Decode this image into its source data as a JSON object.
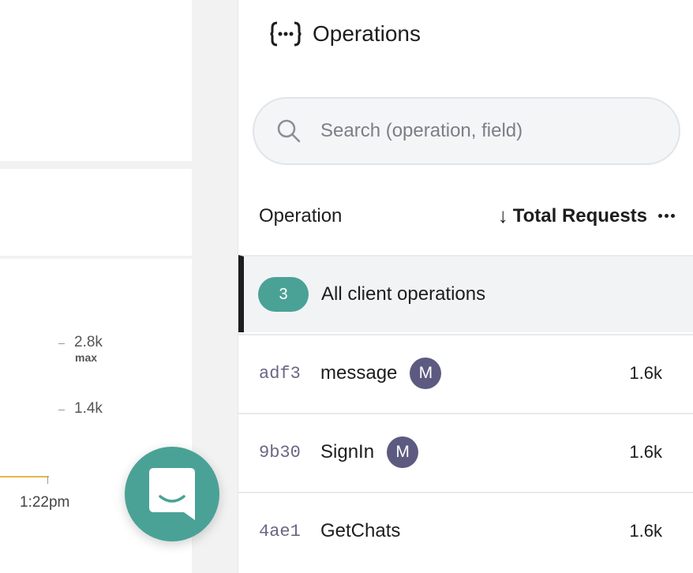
{
  "chart": {
    "ticks": [
      {
        "label": "2.8k",
        "sub": "max"
      },
      {
        "label": "1.4k",
        "sub": ""
      }
    ],
    "time_label": "1:22pm",
    "series_color": "#e7b64a"
  },
  "panel": {
    "icon": "graphql-operations-icon",
    "title": "Operations"
  },
  "search": {
    "placeholder": "Search (operation, field)",
    "value": ""
  },
  "table": {
    "col_operation": "Operation",
    "col_requests": "Total Requests",
    "sort_direction": "descending",
    "summary_row": {
      "count": "3",
      "label": "All client operations"
    },
    "rows": [
      {
        "id": "adf3",
        "name": "message",
        "badge": "M",
        "requests": "1.6k"
      },
      {
        "id": "9b30",
        "name": "SignIn",
        "badge": "M",
        "requests": "1.6k"
      },
      {
        "id": "4ae1",
        "name": "GetChats",
        "badge": "",
        "requests": "1.6k"
      }
    ]
  },
  "colors": {
    "accent": "#4aa296",
    "badge": "#5c5a80",
    "op_id": "#6d6585"
  }
}
